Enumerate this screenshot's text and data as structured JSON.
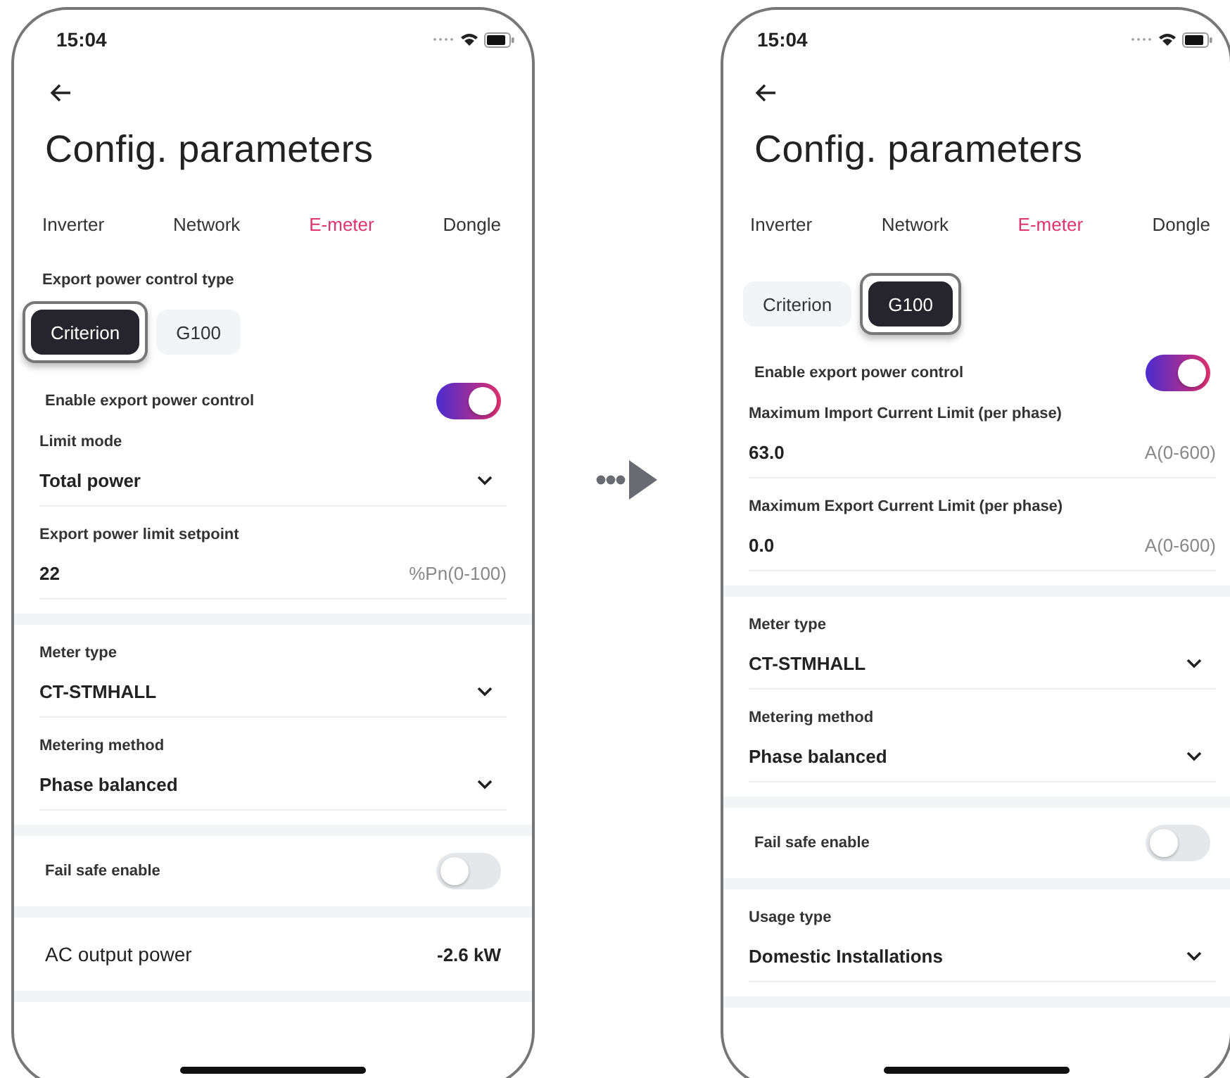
{
  "phones": [
    {
      "status_time": "15:04",
      "title": "Config. parameters",
      "tabs": [
        {
          "label": "Inverter",
          "selected": false
        },
        {
          "label": "Network",
          "selected": false
        },
        {
          "label": "E-meter",
          "selected": true
        },
        {
          "label": "Dongle",
          "selected": false
        }
      ],
      "groups": [
        [
          {
            "kind": "segmented",
            "label": "Export power control type",
            "options": [
              {
                "label": "Criterion",
                "selected": true
              },
              {
                "label": "G100",
                "selected": false
              }
            ]
          },
          {
            "kind": "switch",
            "label": "Enable export power control",
            "on": true
          },
          {
            "kind": "select",
            "label": "Limit mode",
            "value": "Total power"
          },
          {
            "kind": "input",
            "label": "Export power limit setpoint",
            "value": "22",
            "unit": "%Pn(0-100)"
          }
        ],
        [
          {
            "kind": "select",
            "label": "Meter type",
            "value": "CT-STMHALL"
          },
          {
            "kind": "select",
            "label": "Metering method",
            "value": "Phase balanced"
          }
        ],
        [
          {
            "kind": "switch",
            "label": "Fail safe enable",
            "on": false
          }
        ],
        [
          {
            "kind": "readout",
            "label": "AC output power",
            "value": "-2.6 kW"
          }
        ]
      ]
    },
    {
      "status_time": "15:04",
      "title": "Config. parameters",
      "tabs": [
        {
          "label": "Inverter",
          "selected": false
        },
        {
          "label": "Network",
          "selected": false
        },
        {
          "label": "E-meter",
          "selected": true
        },
        {
          "label": "Dongle",
          "selected": false
        }
      ],
      "groups": [
        [
          {
            "kind": "segmented",
            "options": [
              {
                "label": "Criterion",
                "selected": false
              },
              {
                "label": "G100",
                "selected": true
              }
            ]
          },
          {
            "kind": "switch",
            "label": "Enable export power control",
            "on": true
          },
          {
            "kind": "input",
            "label": "Maximum Import Current Limit (per phase)",
            "value": "63.0",
            "unit": "A(0-600)"
          },
          {
            "kind": "input",
            "label": "Maximum Export Current Limit (per phase)",
            "value": "0.0",
            "unit": "A(0-600)"
          }
        ],
        [
          {
            "kind": "select",
            "label": "Meter type",
            "value": "CT-STMHALL"
          },
          {
            "kind": "select",
            "label": "Metering method",
            "value": "Phase balanced"
          }
        ],
        [
          {
            "kind": "switch",
            "label": "Fail safe enable",
            "on": false
          }
        ],
        [
          {
            "kind": "select",
            "label": "Usage type",
            "value": "Domestic Installations"
          }
        ]
      ]
    }
  ]
}
